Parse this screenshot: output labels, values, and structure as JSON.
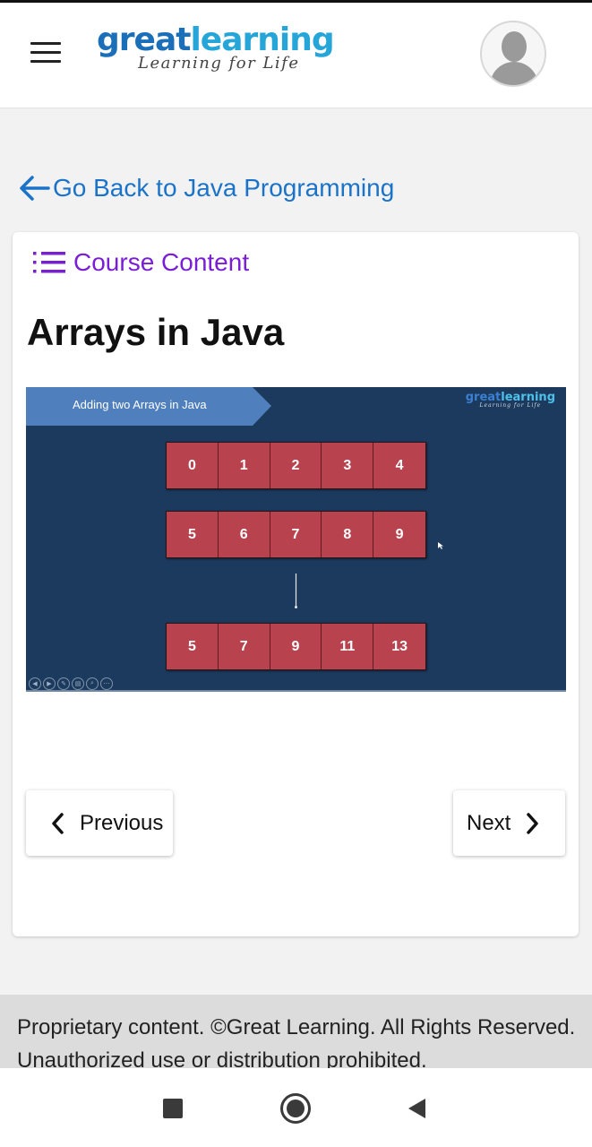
{
  "header": {
    "logo": {
      "word_part1": "great",
      "word_part2": "learning",
      "tagline": "Learning for Life"
    },
    "menu_icon": "hamburger-icon",
    "avatar_icon": "user-avatar-icon"
  },
  "back_link": {
    "label": "Go Back to Java Programming",
    "icon": "arrow-left-icon"
  },
  "card": {
    "course_content_label": "Course Content",
    "course_content_icon": "list-icon",
    "lesson_title": "Arrays in Java",
    "video": {
      "slide_title": "Adding two Arrays in Java",
      "slide_logo": {
        "word_part1": "great",
        "word_part2": "learning",
        "tagline": "Learning for Life"
      },
      "array_a": [
        "0",
        "1",
        "2",
        "3",
        "4"
      ],
      "array_b": [
        "5",
        "6",
        "7",
        "8",
        "9"
      ],
      "array_sum": [
        "5",
        "7",
        "9",
        "11",
        "13"
      ],
      "controls": [
        "◀",
        "▶",
        "✎",
        "▤",
        "⌕",
        "⋯"
      ]
    },
    "previous_label": "Previous",
    "next_label": "Next"
  },
  "footer": {
    "text": "Proprietary content. ©Great Learning. All Rights Reserved. Unauthorized use or distribution prohibited."
  },
  "system_nav": {
    "recents_icon": "square-icon",
    "home_icon": "circle-icon",
    "back_icon": "triangle-back-icon"
  },
  "colors": {
    "link_blue": "#1a73c9",
    "course_purple": "#7a1ed6",
    "slide_bg": "#1c3a5e",
    "cell_red": "#b8424d",
    "ribbon_blue": "#4f7fbd"
  }
}
